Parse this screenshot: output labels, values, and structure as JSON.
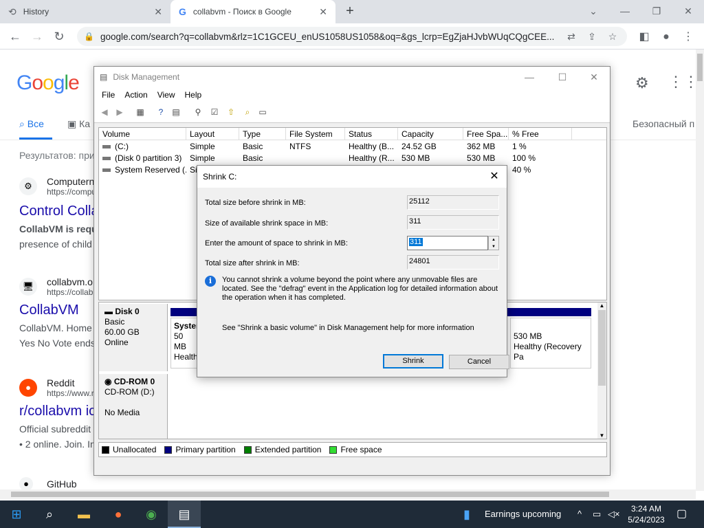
{
  "browser": {
    "tabs": [
      {
        "title": "History",
        "icon": "history-icon"
      },
      {
        "title": "collabvm - Поиск в Google",
        "icon": "google-g-icon"
      }
    ],
    "url": "google.com/search?q=collabvm&rlz=1C1GCEU_enUS1058US1058&oq=&gs_lcrp=EgZjaHJvbWUqCQgCEE..."
  },
  "google": {
    "logo": "Google",
    "tabs": [
      "Все",
      "Ка"
    ],
    "safe_search": "Безопасный п",
    "stats": "Результатов: при",
    "results": [
      {
        "site": "Computern",
        "url": "https://compu",
        "title": "Control Colla",
        "snippet1": "CollabVM is requ",
        "snippet2": "presence of child"
      },
      {
        "site": "collabvm.o",
        "url": "https://collab",
        "title": "CollabVM",
        "snippet1": "CollabVM. Home",
        "snippet2": "Yes No Vote ends"
      },
      {
        "site": "Reddit",
        "url": "https://www.r",
        "title": "r/collabvm ic",
        "snippet1": "Official subreddit",
        "snippet2": "• 2 online. Join. In"
      },
      {
        "site": "GitHub",
        "url": "",
        "title": "",
        "snippet1": "",
        "snippet2": ""
      }
    ]
  },
  "diskmgmt": {
    "title": "Disk Management",
    "menu": [
      "File",
      "Action",
      "View",
      "Help"
    ],
    "columns": [
      "Volume",
      "Layout",
      "Type",
      "File System",
      "Status",
      "Capacity",
      "Free Spa...",
      "% Free"
    ],
    "rows": [
      [
        "(C:)",
        "Simple",
        "Basic",
        "NTFS",
        "Healthy (B...",
        "24.52 GB",
        "362 MB",
        "1 %"
      ],
      [
        "(Disk 0 partition 3)",
        "Simple",
        "Basic",
        "",
        "Healthy (R...",
        "530 MB",
        "530 MB",
        "100 %"
      ],
      [
        "System Reserved (...",
        "Si",
        "",
        "",
        "",
        "",
        "",
        "40 %"
      ]
    ],
    "disk0": {
      "name": "Disk 0",
      "type": "Basic",
      "size": "60.00 GB",
      "status": "Online"
    },
    "disk0_part_left": {
      "name": "Syster",
      "size": "50 MB",
      "status": "Health"
    },
    "disk0_part_right": {
      "size": "530 MB",
      "status": "Healthy (Recovery Pa"
    },
    "cdrom": {
      "name": "CD-ROM 0",
      "drive": "CD-ROM (D:)",
      "media": "No Media"
    },
    "legend": [
      {
        "label": "Unallocated",
        "color": "#000000"
      },
      {
        "label": "Primary partition",
        "color": "#00007f"
      },
      {
        "label": "Extended partition",
        "color": "#007f00"
      },
      {
        "label": "Free space",
        "color": "#33dd33"
      }
    ]
  },
  "shrink": {
    "title": "Shrink C:",
    "total_before_label": "Total size before shrink in MB:",
    "total_before": "25112",
    "available_label": "Size of available shrink space in MB:",
    "available": "311",
    "amount_label": "Enter the amount of space to shrink in MB:",
    "amount": "311",
    "total_after_label": "Total size after shrink in MB:",
    "total_after": "24801",
    "info": "You cannot shrink a volume beyond the point where any unmovable files are located. See the \"defrag\" event in the Application log for detailed information about the operation when it has completed.",
    "help": "See \"Shrink a basic volume\" in Disk Management help for more information",
    "shrink_label": "Shrink",
    "cancel_label": "Cancel"
  },
  "taskbar": {
    "notification": "Earnings upcoming",
    "time": "3:24 AM",
    "date": "5/24/2023"
  }
}
